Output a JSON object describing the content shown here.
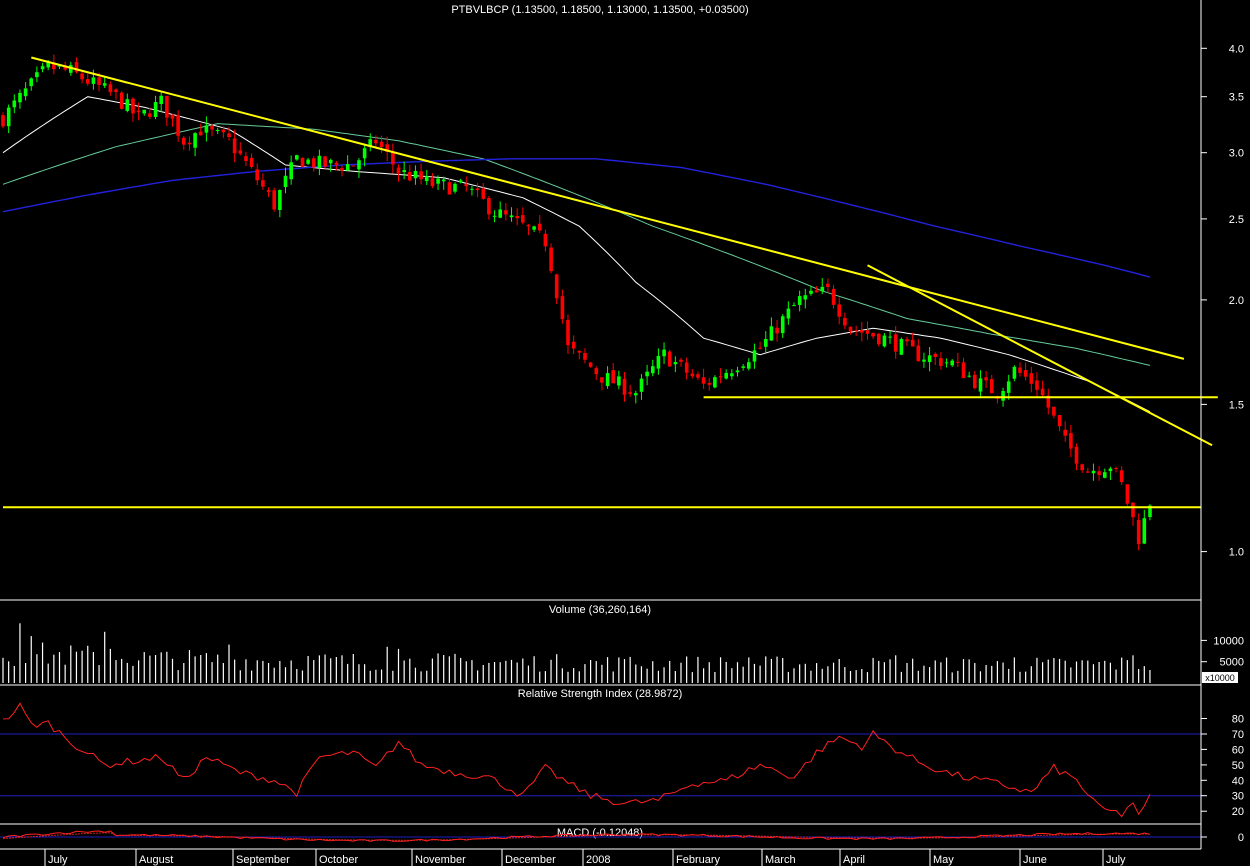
{
  "colors": {
    "background": "#000000",
    "up": "#00ff00",
    "down": "#ff0000",
    "trendline": "#ffff00",
    "ma_short": "#ffffff",
    "ma_mid": "#66cc99",
    "ma_long": "#2222dd",
    "rsi_line": "#ff2020",
    "rsi_levels": "#2020c0",
    "macd_line": "#ff2020",
    "macd_signal": "#cc2222",
    "volume": "#ffffff",
    "axis": "#ffffff"
  },
  "chart_data": [
    {
      "type": "candlestick",
      "title": "PTBVLBCP (1.13500, 1.18500, 1.13000, 1.13500, +0.03500)",
      "scale": "log",
      "ylim": [
        0.88,
        4.3
      ],
      "y_ticks": [
        4.0,
        3.5,
        3.0,
        2.5,
        2.0,
        1.5,
        1.0
      ],
      "y_tick_labels": [
        "4.0",
        "3.5",
        "3.0",
        "2.5",
        "2.0",
        "1.5",
        "1.0"
      ],
      "x_labels": [
        "July",
        "August",
        "September",
        "October",
        "November",
        "December",
        "2008",
        "February",
        "March",
        "April",
        "May",
        "June",
        "July"
      ],
      "close_path": [
        [
          0,
          3.3
        ],
        [
          8,
          3.8
        ],
        [
          12,
          3.75
        ],
        [
          20,
          3.5
        ],
        [
          24,
          3.3
        ],
        [
          28,
          3.45
        ],
        [
          32,
          3.1
        ],
        [
          35,
          3.2
        ],
        [
          40,
          3.1
        ],
        [
          44,
          2.85
        ],
        [
          48,
          2.6
        ],
        [
          52,
          2.95
        ],
        [
          57,
          2.9
        ],
        [
          62,
          2.9
        ],
        [
          66,
          3.1
        ],
        [
          70,
          2.85
        ],
        [
          76,
          2.75
        ],
        [
          82,
          2.72
        ],
        [
          87,
          2.55
        ],
        [
          92,
          2.45
        ],
        [
          96,
          2.35
        ],
        [
          100,
          1.75
        ],
        [
          106,
          1.62
        ],
        [
          112,
          1.55
        ],
        [
          117,
          1.72
        ],
        [
          124,
          1.58
        ],
        [
          129,
          1.66
        ],
        [
          134,
          1.75
        ],
        [
          141,
          2.0
        ],
        [
          146,
          2.05
        ],
        [
          150,
          1.85
        ],
        [
          156,
          1.8
        ],
        [
          162,
          1.72
        ],
        [
          168,
          1.68
        ],
        [
          172,
          1.6
        ],
        [
          176,
          1.55
        ],
        [
          179,
          1.65
        ],
        [
          183,
          1.58
        ],
        [
          188,
          1.35
        ],
        [
          192,
          1.25
        ],
        [
          196,
          1.27
        ],
        [
          198,
          1.2
        ],
        [
          201,
          1.04
        ],
        [
          203,
          1.135
        ]
      ],
      "moving_averages": [
        {
          "points": [
            [
              0,
              3.0
            ],
            [
              15,
              3.5
            ],
            [
              25,
              3.4
            ],
            [
              40,
              3.2
            ],
            [
              50,
              2.9
            ],
            [
              62,
              2.85
            ],
            [
              78,
              2.8
            ],
            [
              92,
              2.65
            ],
            [
              102,
              2.45
            ],
            [
              112,
              2.1
            ],
            [
              124,
              1.8
            ],
            [
              134,
              1.72
            ],
            [
              144,
              1.8
            ],
            [
              154,
              1.85
            ],
            [
              166,
              1.8
            ],
            [
              178,
              1.72
            ],
            [
              192,
              1.6
            ],
            [
              203,
              1.47
            ]
          ]
        },
        {
          "points": [
            [
              0,
              2.75
            ],
            [
              20,
              3.05
            ],
            [
              38,
              3.25
            ],
            [
              55,
              3.2
            ],
            [
              70,
              3.1
            ],
            [
              85,
              2.95
            ],
            [
              100,
              2.7
            ],
            [
              115,
              2.45
            ],
            [
              130,
              2.25
            ],
            [
              145,
              2.05
            ],
            [
              160,
              1.9
            ],
            [
              175,
              1.82
            ],
            [
              190,
              1.75
            ],
            [
              203,
              1.67
            ]
          ]
        },
        {
          "points": [
            [
              0,
              2.55
            ],
            [
              15,
              2.67
            ],
            [
              30,
              2.78
            ],
            [
              45,
              2.85
            ],
            [
              60,
              2.9
            ],
            [
              75,
              2.93
            ],
            [
              90,
              2.95
            ],
            [
              105,
              2.95
            ],
            [
              120,
              2.88
            ],
            [
              135,
              2.75
            ],
            [
              150,
              2.6
            ],
            [
              165,
              2.45
            ],
            [
              180,
              2.32
            ],
            [
              195,
              2.2
            ],
            [
              203,
              2.13
            ]
          ]
        }
      ],
      "trendlines": [
        {
          "from": [
            5,
            3.9
          ],
          "to": [
            209,
            1.7
          ]
        },
        {
          "from": [
            153,
            2.2
          ],
          "to": [
            214,
            1.34
          ]
        },
        {
          "from": [
            124,
            1.53
          ],
          "to": [
            215,
            1.53
          ]
        },
        {
          "from": [
            0,
            1.13
          ],
          "to": [
            212,
            1.13
          ]
        }
      ]
    },
    {
      "type": "bar",
      "title": "Volume (36,260,164)",
      "ylim": [
        0,
        19000
      ],
      "y_ticks": [
        10000,
        5000
      ],
      "y_tick_labels": [
        "10000",
        "5000"
      ],
      "unit_label": "x10000",
      "profile": [
        [
          0,
          7000
        ],
        [
          30,
          5500
        ],
        [
          60,
          5000
        ],
        [
          90,
          4800
        ],
        [
          120,
          4500
        ],
        [
          150,
          4300
        ],
        [
          180,
          4200
        ],
        [
          203,
          4500
        ]
      ],
      "spikes": [
        [
          3,
          14000
        ],
        [
          5,
          11000
        ],
        [
          18,
          12000
        ],
        [
          19,
          8000
        ],
        [
          40,
          9000
        ],
        [
          68,
          8500
        ],
        [
          70,
          8000
        ],
        [
          110,
          5600
        ],
        [
          132,
          6000
        ],
        [
          158,
          6500
        ],
        [
          179,
          6000
        ],
        [
          200,
          6500
        ]
      ]
    },
    {
      "type": "line",
      "title": "Relative Strength Index (28.9872)",
      "ylim": [
        13,
        92
      ],
      "y_ticks": [
        80,
        70,
        60,
        50,
        40,
        30,
        20
      ],
      "y_tick_labels": [
        "80",
        "70",
        "60",
        "50",
        "40",
        "30",
        "20"
      ],
      "levels": [
        70,
        30
      ],
      "values": [
        [
          0,
          78
        ],
        [
          3,
          88
        ],
        [
          5,
          76
        ],
        [
          8,
          77
        ],
        [
          12,
          65
        ],
        [
          18,
          50
        ],
        [
          22,
          52
        ],
        [
          28,
          55
        ],
        [
          32,
          40
        ],
        [
          36,
          55
        ],
        [
          42,
          45
        ],
        [
          48,
          40
        ],
        [
          52,
          32
        ],
        [
          56,
          55
        ],
        [
          62,
          58
        ],
        [
          66,
          48
        ],
        [
          70,
          65
        ],
        [
          74,
          50
        ],
        [
          80,
          45
        ],
        [
          86,
          42
        ],
        [
          92,
          30
        ],
        [
          96,
          48
        ],
        [
          100,
          38
        ],
        [
          104,
          30
        ],
        [
          110,
          25
        ],
        [
          116,
          27
        ],
        [
          122,
          38
        ],
        [
          128,
          40
        ],
        [
          134,
          50
        ],
        [
          140,
          42
        ],
        [
          144,
          58
        ],
        [
          148,
          68
        ],
        [
          152,
          62
        ],
        [
          154,
          70
        ],
        [
          158,
          60
        ],
        [
          162,
          52
        ],
        [
          166,
          46
        ],
        [
          170,
          42
        ],
        [
          176,
          38
        ],
        [
          182,
          32
        ],
        [
          186,
          48
        ],
        [
          190,
          40
        ],
        [
          194,
          22
        ],
        [
          198,
          18
        ],
        [
          200,
          26
        ],
        [
          201,
          16
        ],
        [
          203,
          29
        ]
      ]
    },
    {
      "type": "line",
      "title": "MACD (-0.12048)",
      "ylim": [
        -3,
        3
      ],
      "y_ticks": [
        0
      ],
      "y_tick_labels": [
        "0"
      ]
    }
  ]
}
